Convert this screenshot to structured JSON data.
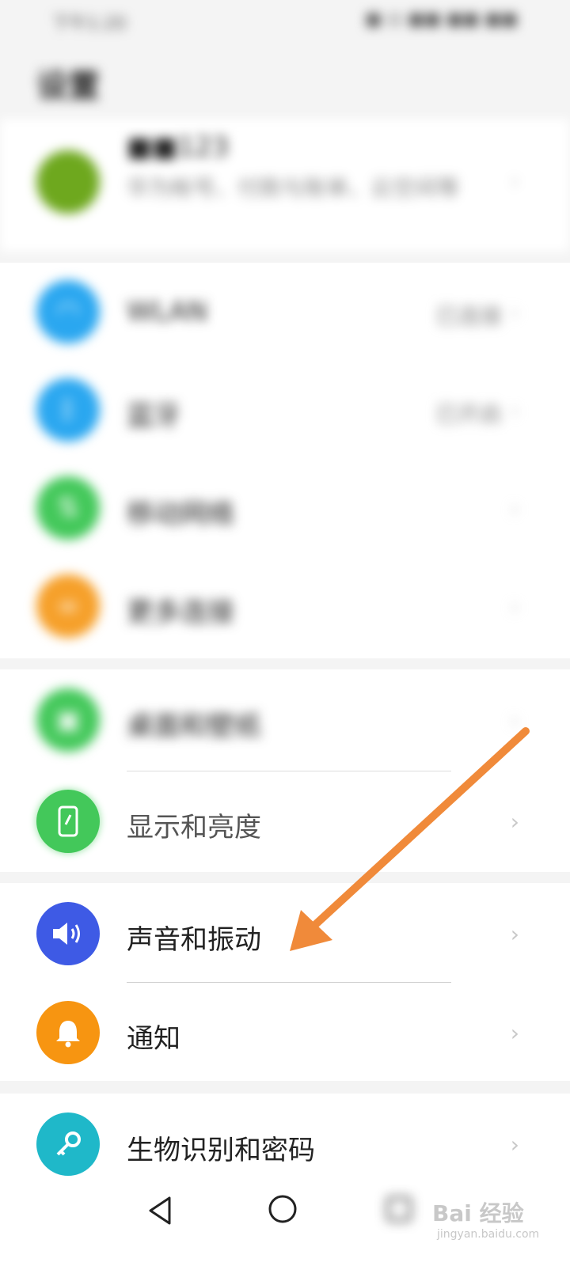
{
  "status_bar": {
    "left_text": "下午1:20",
    "right_text": "■ ◎ ■■ ■■ ■■"
  },
  "header": {
    "title": "设置"
  },
  "account": {
    "name": "■■123",
    "subtitle": "华为帐号、付款与账单、云空间等"
  },
  "items": [
    {
      "label": "WLAN",
      "value": "已连接",
      "icon": "wifi-icon",
      "color": "#2aa7f0"
    },
    {
      "label": "蓝牙",
      "value": "已开启",
      "icon": "bluetooth-icon",
      "color": "#2aa7f0"
    },
    {
      "label": "移动网络",
      "value": "",
      "icon": "mobile-network-icon",
      "color": "#43c85a"
    },
    {
      "label": "更多连接",
      "value": "",
      "icon": "link-icon",
      "color": "#f6a02a"
    },
    {
      "label": "桌面和壁纸",
      "value": "",
      "icon": "wallpaper-icon",
      "color": "#43c85a"
    },
    {
      "label": "显示和亮度",
      "value": "",
      "icon": "display-icon",
      "color": "#43c85a"
    },
    {
      "label": "声音和振动",
      "value": "",
      "icon": "sound-icon",
      "color": "#3e5ae5"
    },
    {
      "label": "通知",
      "value": "",
      "icon": "bell-icon",
      "color": "#f79511"
    },
    {
      "label": "生物识别和密码",
      "value": "",
      "icon": "key-icon",
      "color": "#1fb8c9"
    }
  ],
  "watermark": {
    "text": "Bai 经验",
    "sub": "jingyan.baidu.com"
  },
  "colors": {
    "arrow": "#f08a3a",
    "background": "#f4f4f4"
  }
}
